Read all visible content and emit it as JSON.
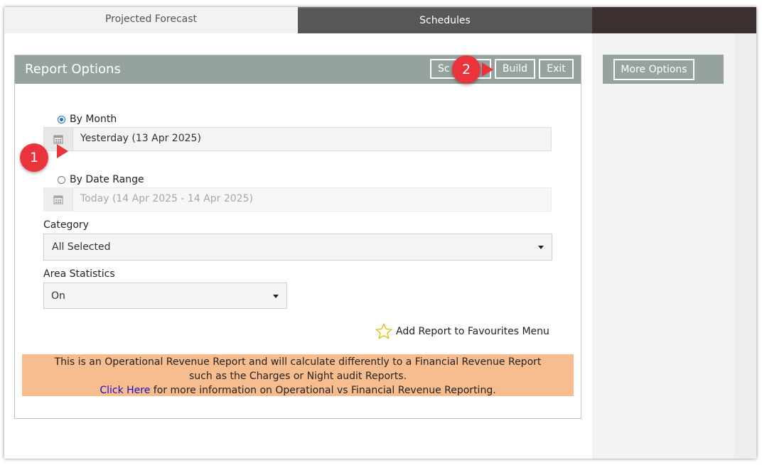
{
  "tabs": [
    {
      "label": "Projected Forecast"
    },
    {
      "label": "Schedules"
    }
  ],
  "panel": {
    "title": "Report Options",
    "buttons": {
      "schedule_partial": "Sc",
      "build": "Build",
      "exit": "Exit"
    }
  },
  "form": {
    "by_month": {
      "label": "By Month",
      "value": "Yesterday (13 Apr 2025)",
      "checked": true
    },
    "by_date_range": {
      "label": "By Date Range",
      "value": "Today (14 Apr 2025 - 14 Apr 2025)",
      "checked": false
    },
    "category": {
      "label": "Category",
      "value": "All Selected"
    },
    "area_statistics": {
      "label": "Area Statistics",
      "value": "On"
    },
    "favourite": {
      "label": "Add Report to Favourites Menu"
    }
  },
  "notice": {
    "line1": "This is an Operational Revenue Report and will calculate differently to a Financial Revenue Report",
    "line2": "such as the Charges or Night audit Reports.",
    "link": "Click Here",
    "line3_rest": " for more information on Operational vs Financial Revenue Reporting."
  },
  "side": {
    "more_options": "More Options"
  },
  "callouts": {
    "one": "1",
    "two": "2"
  },
  "colors": {
    "header": "#95a29f",
    "notice_bg": "#f8bd8e",
    "callout": "#e8343a",
    "link": "#1a0dcc"
  },
  "icons": {
    "calendar": "calendar-icon",
    "star": "star-outline-icon",
    "caret": "caret-down-icon"
  }
}
